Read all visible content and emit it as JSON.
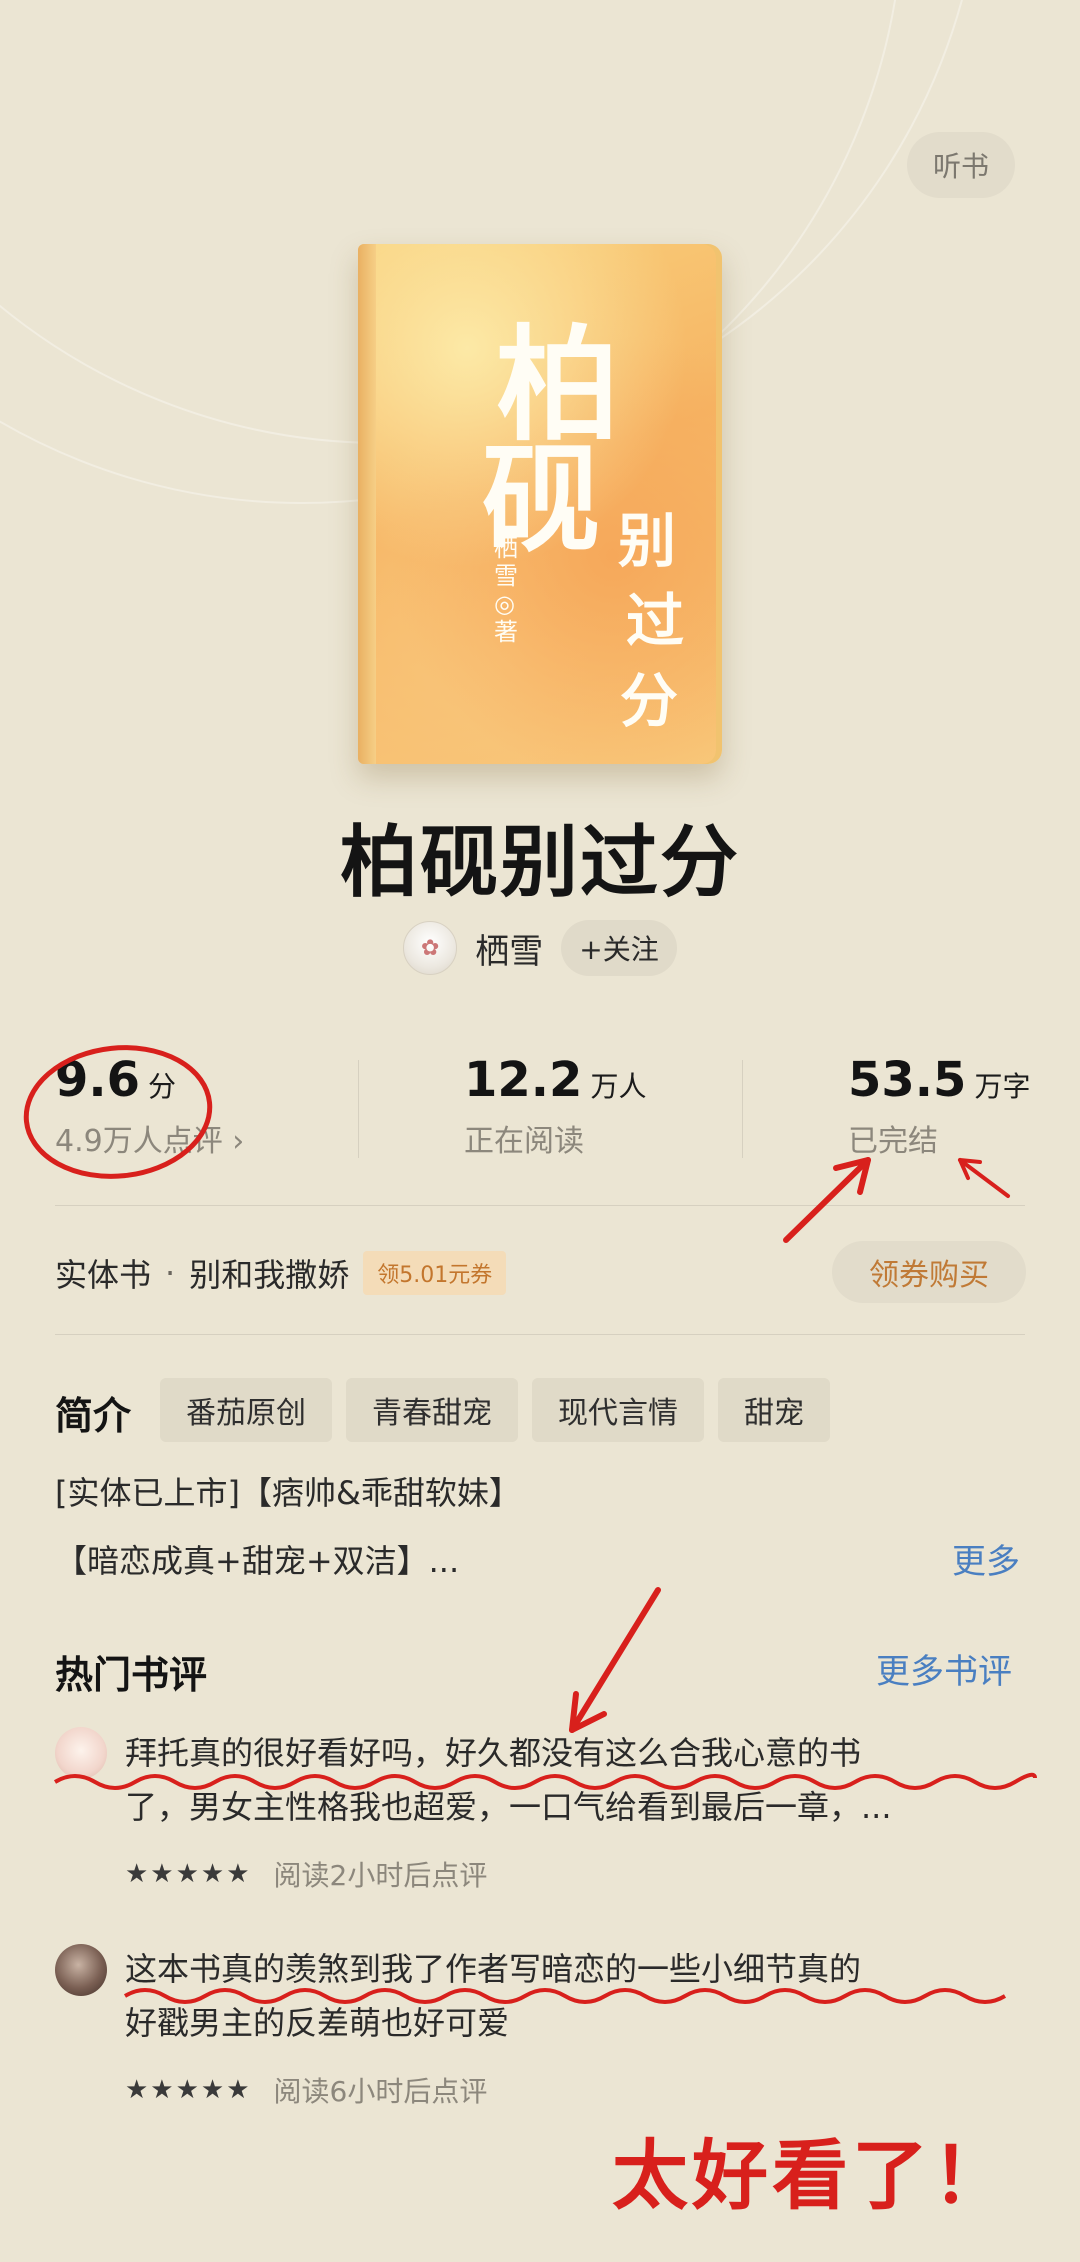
{
  "header": {
    "listen_label": "听书"
  },
  "book": {
    "cover_title_1": "柏",
    "cover_title_2": "砚",
    "cover_sub": [
      "别",
      "过",
      "分"
    ],
    "cover_author": "栖雪◎著",
    "title": "柏砚别过分",
    "author": "栖雪",
    "follow_label": "+关注"
  },
  "stats": [
    {
      "value": "9.6",
      "unit": "分",
      "sub": "4.9万人点评 ›"
    },
    {
      "value": "12.2",
      "unit": "万人",
      "sub": "正在阅读"
    },
    {
      "value": "53.5",
      "unit": "万字",
      "sub": "已完结"
    }
  ],
  "print_book": {
    "label": "实体书",
    "dot": "·",
    "name": "别和我撒娇",
    "coupon": "领5.01元券",
    "buy_label": "领券购买"
  },
  "intro": {
    "title": "简介",
    "tags": [
      "番茄原创",
      "青春甜宠",
      "现代言情",
      "甜宠"
    ],
    "line1": "[实体已上市]【痞帅&乖甜软妹】",
    "line2": "【暗恋成真+甜宠+双洁】...",
    "more": "更多"
  },
  "reviews": {
    "title": "热门书评",
    "more": "更多书评",
    "items": [
      {
        "line1": "拜托真的很好看好吗，好久都没有这么合我心意的书",
        "line2": "了，男女主性格我也超爱，一口气给看到最后一章，...",
        "stars": "★★★★★",
        "meta": "阅读2小时后点评"
      },
      {
        "line1": "这本书真的羡煞到我了作者写暗恋的一些小细节真的",
        "line2": "好戳男主的反差萌也好可爱",
        "stars": "★★★★★",
        "meta": "阅读6小时后点评"
      }
    ]
  },
  "annotation": {
    "handwritten": "太好看了！"
  },
  "colors": {
    "background": "#ebe5d3",
    "accent_blue": "#4a7fc1",
    "coupon_orange": "#c07a36",
    "annotation_red": "#d8201c"
  }
}
